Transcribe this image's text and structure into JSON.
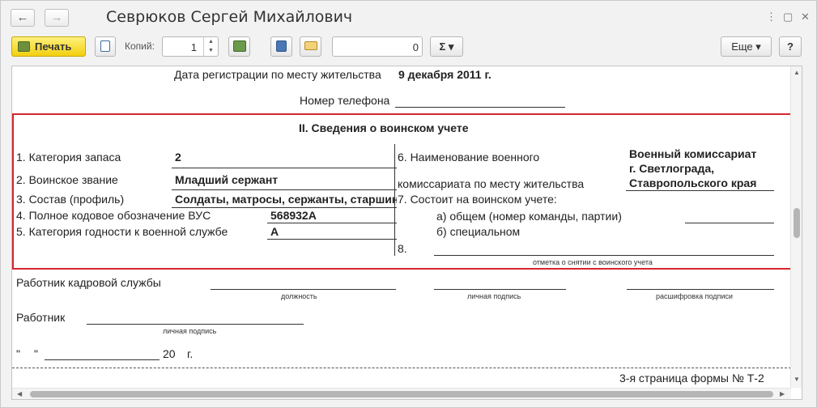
{
  "window": {
    "title": "Севрюков Сергей Михайлович",
    "back_icon": "arrow-left-icon",
    "forward_icon": "arrow-right-icon",
    "menu_glyph": "⋮",
    "restore_glyph": "▢",
    "close_glyph": "✕"
  },
  "toolbar": {
    "print_label": "Печать",
    "copies_label": "Копий:",
    "copies_value": "1",
    "sum_value": "0",
    "sigma_label": "Σ ▾",
    "more_label": "Еще ▾",
    "help_label": "?"
  },
  "document": {
    "reg_date_label": "Дата регистрации по месту жительства",
    "reg_date_value": "9 декабря 2011 г.",
    "phone_label": "Номер телефона",
    "section_title": "II. Сведения о воинском учете",
    "left": [
      {
        "label": "1. Категория запаса",
        "value": "2"
      },
      {
        "label": "2. Воинское звание",
        "value": "Младший сержант"
      },
      {
        "label": "3. Состав (профиль)",
        "value": "Солдаты, матросы, сержанты, старшины"
      },
      {
        "label": "4. Полное кодовое обозначение ВУС",
        "value": "568932А"
      },
      {
        "label": "5. Категория годности к военной службе",
        "value": "А"
      }
    ],
    "right": {
      "item6_line1": "6. Наименование военного",
      "item6_line2": "комиссариата по месту жительства",
      "commissariat_line1": "Военный комиссариат",
      "commissariat_line2": "г. Светлограда,",
      "commissariat_line3": "Ставропольского края",
      "item7": "7. Состоит на воинском учете:",
      "item7a": "а) общем (номер команды, партии)",
      "item7b": "б) специальном",
      "item8": "8.",
      "removal_note": "отметка о снятии с воинского учета"
    },
    "hr_worker_label": "Работник кадровой службы",
    "caption_position": "должность",
    "caption_signature": "личная подпись",
    "caption_decoding": "расшифровка подписи",
    "worker_label": "Работник",
    "worker_signature_caption": "личная подпись",
    "date_quote_open": "\"",
    "date_quote_close": "\"",
    "date_year": "20",
    "date_suffix": "г.",
    "footer": "3-я страница формы № Т-2"
  }
}
